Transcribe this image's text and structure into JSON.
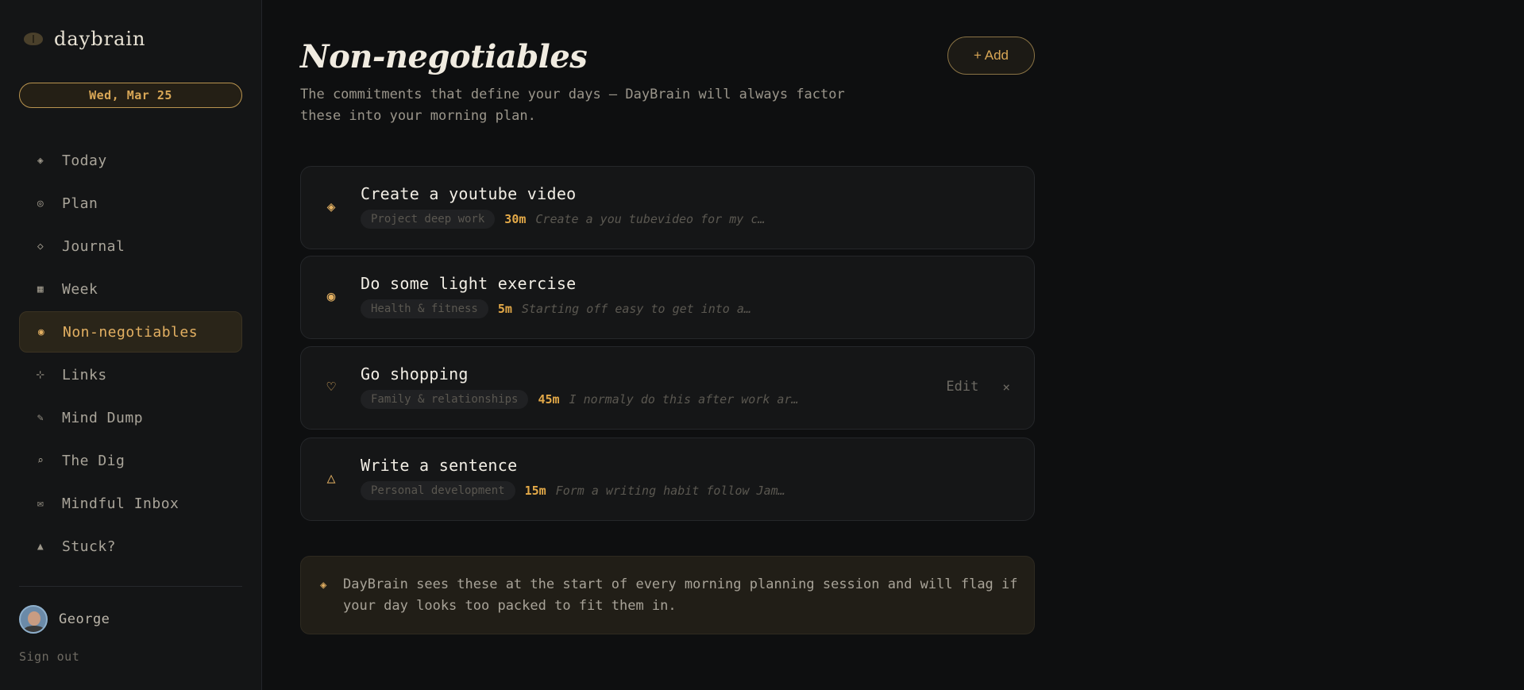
{
  "app": {
    "brand_name": "daybrain",
    "date": "Wed, Mar 25"
  },
  "nav": {
    "items": [
      {
        "label": "Today",
        "icon": "◈",
        "icon_name": "diamond-dot-icon"
      },
      {
        "label": "Plan",
        "icon": "◎",
        "icon_name": "target-icon"
      },
      {
        "label": "Journal",
        "icon": "◇",
        "icon_name": "diamond-icon"
      },
      {
        "label": "Week",
        "icon": "▦",
        "icon_name": "grid-icon"
      },
      {
        "label": "Non-negotiables",
        "icon": "◉",
        "icon_name": "bullseye-icon",
        "active": true
      },
      {
        "label": "Links",
        "icon": "⊹",
        "icon_name": "sparkle-icon"
      },
      {
        "label": "Mind Dump",
        "icon": "✎",
        "icon_name": "pencil-icon"
      },
      {
        "label": "The Dig",
        "icon": "⌕",
        "icon_name": "search-icon"
      },
      {
        "label": "Mindful Inbox",
        "icon": "✉",
        "icon_name": "envelope-icon"
      },
      {
        "label": "Stuck?",
        "icon": "▲",
        "icon_name": "triangle-icon"
      }
    ]
  },
  "user": {
    "name": "George",
    "sign_out": "Sign out"
  },
  "page": {
    "title": "Non-negotiables",
    "subtitle": "The commitments that define your days — DayBrain will always factor these into your morning plan.",
    "add_label": "+ Add"
  },
  "commitments": [
    {
      "title": "Create a youtube video",
      "category": "Project deep work",
      "duration": "30m",
      "note": "Create a you tubevideo for my c…",
      "icon": "◈",
      "icon_name": "diamond-dot-icon"
    },
    {
      "title": "Do some light exercise",
      "category": "Health & fitness",
      "duration": "5m",
      "note": "Starting off easy to get into a…",
      "icon": "◉",
      "icon_name": "bullseye-icon"
    },
    {
      "title": "Go shopping",
      "category": "Family & relationships",
      "duration": "45m",
      "note": "I normaly do this after work ar…",
      "icon": "♡",
      "icon_name": "heart-icon",
      "edit_label": "Edit",
      "remove_label": "×"
    },
    {
      "title": "Write a sentence",
      "category": "Personal development",
      "duration": "15m",
      "note": "Form a writing habit follow Jam…",
      "icon": "△",
      "icon_name": "triangle-outline-icon"
    }
  ],
  "info": {
    "icon": "◈",
    "text": "DayBrain sees these at the start of every morning planning session and will flag if your day looks too packed to fit them in."
  },
  "colors": {
    "accent": "#e3b062",
    "background": "#0e0f10",
    "sidebar": "#141516"
  }
}
